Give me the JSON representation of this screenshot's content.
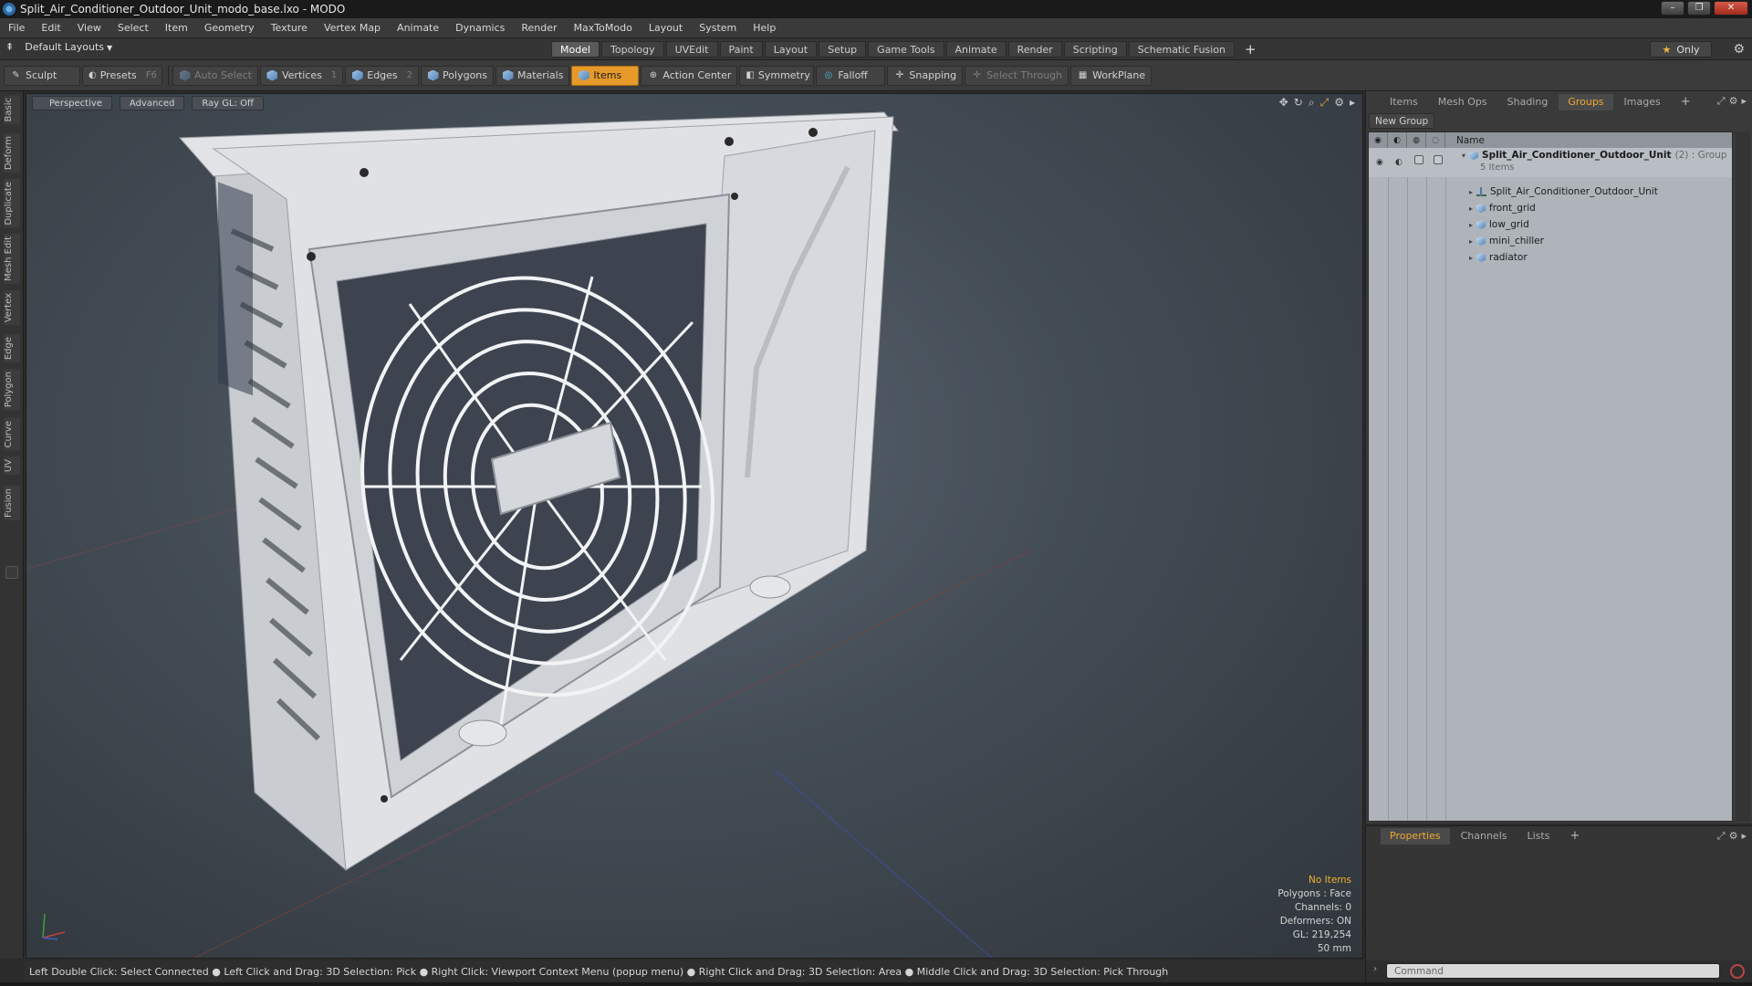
{
  "window": {
    "title": "Split_Air_Conditioner_Outdoor_Unit_modo_base.lxo - MODO",
    "controls": [
      "–",
      "❐",
      "✕"
    ]
  },
  "menu": [
    "File",
    "Edit",
    "View",
    "Select",
    "Item",
    "Geometry",
    "Texture",
    "Vertex Map",
    "Animate",
    "Dynamics",
    "Render",
    "MaxToModo",
    "Layout",
    "System",
    "Help"
  ],
  "layoutbar": {
    "layout_selector": "Default Layouts",
    "tabs": [
      "Model",
      "Topology",
      "UVEdit",
      "Paint",
      "Layout",
      "Setup",
      "Game Tools",
      "Animate",
      "Render",
      "Scripting",
      "Schematic Fusion"
    ],
    "active_tab": "Model",
    "only_label": "Only"
  },
  "toolbar": {
    "sculpt": "Sculpt",
    "presets": "Presets",
    "presets_key": "F6",
    "auto_select": "Auto Select",
    "vertices": "Vertices",
    "vertices_key": "1",
    "edges": "Edges",
    "edges_key": "2",
    "polygons": "Polygons",
    "materials": "Materials",
    "items": "Items",
    "action_center": "Action Center",
    "symmetry": "Symmetry",
    "falloff": "Falloff",
    "snapping": "Snapping",
    "select_through": "Select Through",
    "workplane": "WorkPlane"
  },
  "left_tabs": [
    "Basic",
    "Deform",
    "Duplicate",
    "Mesh Edit",
    "Vertex",
    "Edge",
    "Polygon",
    "Curve",
    "UV",
    "Fusion"
  ],
  "viewport": {
    "view": "Perspective",
    "shading": "Advanced",
    "raygl": "Ray GL: Off",
    "info": {
      "selection": "No Items",
      "polygons": "Polygons : Face",
      "channels": "Channels: 0",
      "deformers": "Deformers: ON",
      "gl": "GL: 219,254",
      "scale": "50 mm"
    }
  },
  "statusbar": "Left Double Click: Select Connected ● Left Click and Drag: 3D Selection: Pick ● Right Click: Viewport Context Menu (popup menu) ● Right Click and Drag: 3D Selection: Area ● Middle Click and Drag: 3D Selection: Pick Through",
  "right_panel": {
    "tabs": [
      "Items",
      "Mesh Ops",
      "Shading",
      "Groups",
      "Images"
    ],
    "active_tab": "Groups",
    "new_group": "New Group",
    "name_header": "Name",
    "group": {
      "name": "Split_Air_Conditioner_Outdoor_Unit",
      "suffix": "(2) : Group",
      "count": "5 Items"
    },
    "items": [
      "Split_Air_Conditioner_Outdoor_Unit",
      "front_grid",
      "low_grid",
      "mini_chiller",
      "radiator"
    ]
  },
  "props_panel": {
    "tabs": [
      "Properties",
      "Channels",
      "Lists"
    ],
    "active_tab": "Properties"
  },
  "command": {
    "placeholder": "Command"
  },
  "colors": {
    "accent": "#e69a2a",
    "active_tab_text": "#f0a830"
  }
}
